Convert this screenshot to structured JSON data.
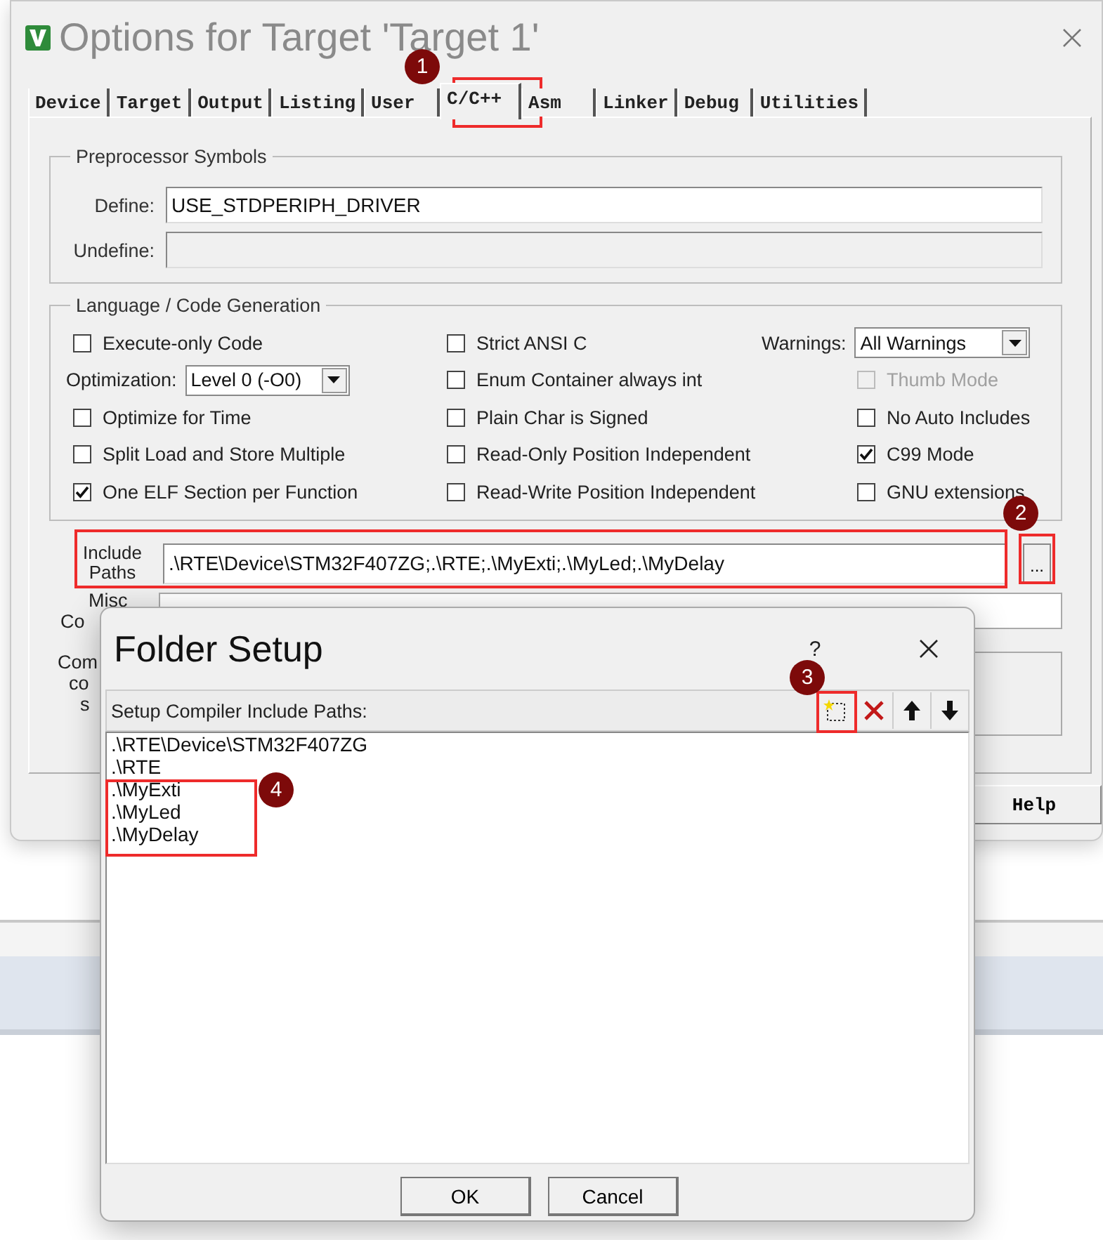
{
  "options_window": {
    "title": "Options for Target 'Target 1'",
    "tabs": [
      {
        "label": "Device",
        "selected": false
      },
      {
        "label": "Target",
        "selected": false
      },
      {
        "label": "Output",
        "selected": false
      },
      {
        "label": "Listing",
        "selected": false
      },
      {
        "label": "User",
        "selected": false
      },
      {
        "label": "C/C++",
        "selected": true
      },
      {
        "label": "Asm",
        "selected": false
      },
      {
        "label": "Linker",
        "selected": false
      },
      {
        "label": "Debug",
        "selected": false
      },
      {
        "label": "Utilities",
        "selected": false
      }
    ],
    "preprocessor": {
      "title": "Preprocessor Symbols",
      "fields": [
        {
          "label": "Define:",
          "value": "USE_STDPERIPH_DRIVER",
          "disabled": false
        },
        {
          "label": "Undefine:",
          "disabled": true
        }
      ]
    },
    "language": {
      "title": "Language / Code Generation",
      "columns": [
        [
          {
            "kind": "checkbox",
            "label": "Execute-only Code",
            "checked": false,
            "disabled": false
          },
          {
            "kind": "select",
            "label": "Optimization:",
            "value": "Level 0 (-O0)"
          },
          {
            "kind": "checkbox",
            "label": "Optimize for Time",
            "checked": false,
            "disabled": false
          },
          {
            "kind": "checkbox",
            "label": "Split Load and Store Multiple",
            "checked": false,
            "disabled": false
          },
          {
            "kind": "checkbox",
            "label": "One ELF Section per Function",
            "checked": true,
            "disabled": false
          }
        ],
        [
          {
            "kind": "checkbox",
            "label": "Strict ANSI C",
            "checked": false,
            "disabled": false
          },
          {
            "kind": "checkbox",
            "label": "Enum Container always int",
            "checked": false,
            "disabled": false
          },
          {
            "kind": "checkbox",
            "label": "Plain Char is Signed",
            "checked": false,
            "disabled": false
          },
          {
            "kind": "checkbox",
            "label": "Read-Only Position Independent",
            "checked": false,
            "disabled": false
          },
          {
            "kind": "checkbox",
            "label": "Read-Write Position Independent",
            "checked": false,
            "disabled": false
          }
        ],
        [
          {
            "kind": "select",
            "label": "Warnings:",
            "value": "All Warnings"
          },
          {
            "kind": "checkbox",
            "label": "Thumb Mode",
            "checked": false,
            "disabled": true
          },
          {
            "kind": "checkbox",
            "label": "No Auto Includes",
            "checked": false,
            "disabled": false
          },
          {
            "kind": "checkbox",
            "label": "C99 Mode",
            "checked": true,
            "disabled": false
          },
          {
            "kind": "checkbox",
            "label": "GNU extensions",
            "checked": false,
            "disabled": false
          }
        ]
      ]
    },
    "include_paths": {
      "label_lines": [
        "Include",
        "Paths"
      ],
      "value": ".\\RTE\\Device\\STM32F407ZG;.\\RTE;.\\MyExti;.\\MyLed;.\\MyDelay",
      "browse_button": "..."
    },
    "misc_labels": [
      "Misc",
      "Co"
    ],
    "compiler_string_labels": [
      "Com",
      "co",
      "s"
    ],
    "help_button": "Help"
  },
  "folder_setup": {
    "title": "Folder Setup",
    "help": "?",
    "list_title": "Setup Compiler Include Paths:",
    "paths": [
      ".\\RTE\\Device\\STM32F407ZG",
      ".\\RTE",
      ".\\MyExti",
      ".\\MyLed",
      ".\\MyDelay"
    ],
    "buttons": [
      "OK",
      "Cancel"
    ]
  },
  "annotations": [
    {
      "number": "1"
    },
    {
      "number": "2"
    },
    {
      "number": "3"
    },
    {
      "number": "4"
    }
  ]
}
